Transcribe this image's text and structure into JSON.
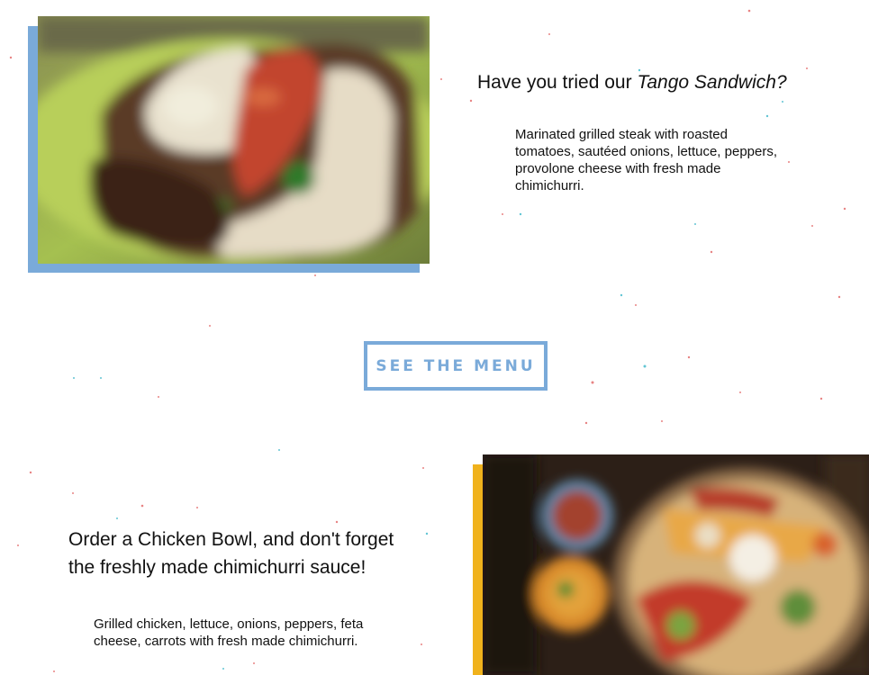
{
  "feature_sandwich": {
    "heading_prefix": "Have you tried our ",
    "heading_emphasis": "Tango Sandwich?",
    "description": "Marinated grilled steak with roasted tomatoes, sautéed onions, lettuce, peppers, provolone cheese with fresh made chimichurri.",
    "accent_color": "#7aaad9"
  },
  "menu_button": {
    "label": "SEE THE MENU",
    "color": "#7aaad9"
  },
  "feature_bowl": {
    "heading": "Order a Chicken Bowl, and don't forget the freshly made chimichurri sauce!",
    "description": "Grilled chicken, lettuce, onions, peppers, feta cheese, carrots with fresh made chimichurri.",
    "accent_color": "#f0b21c"
  }
}
